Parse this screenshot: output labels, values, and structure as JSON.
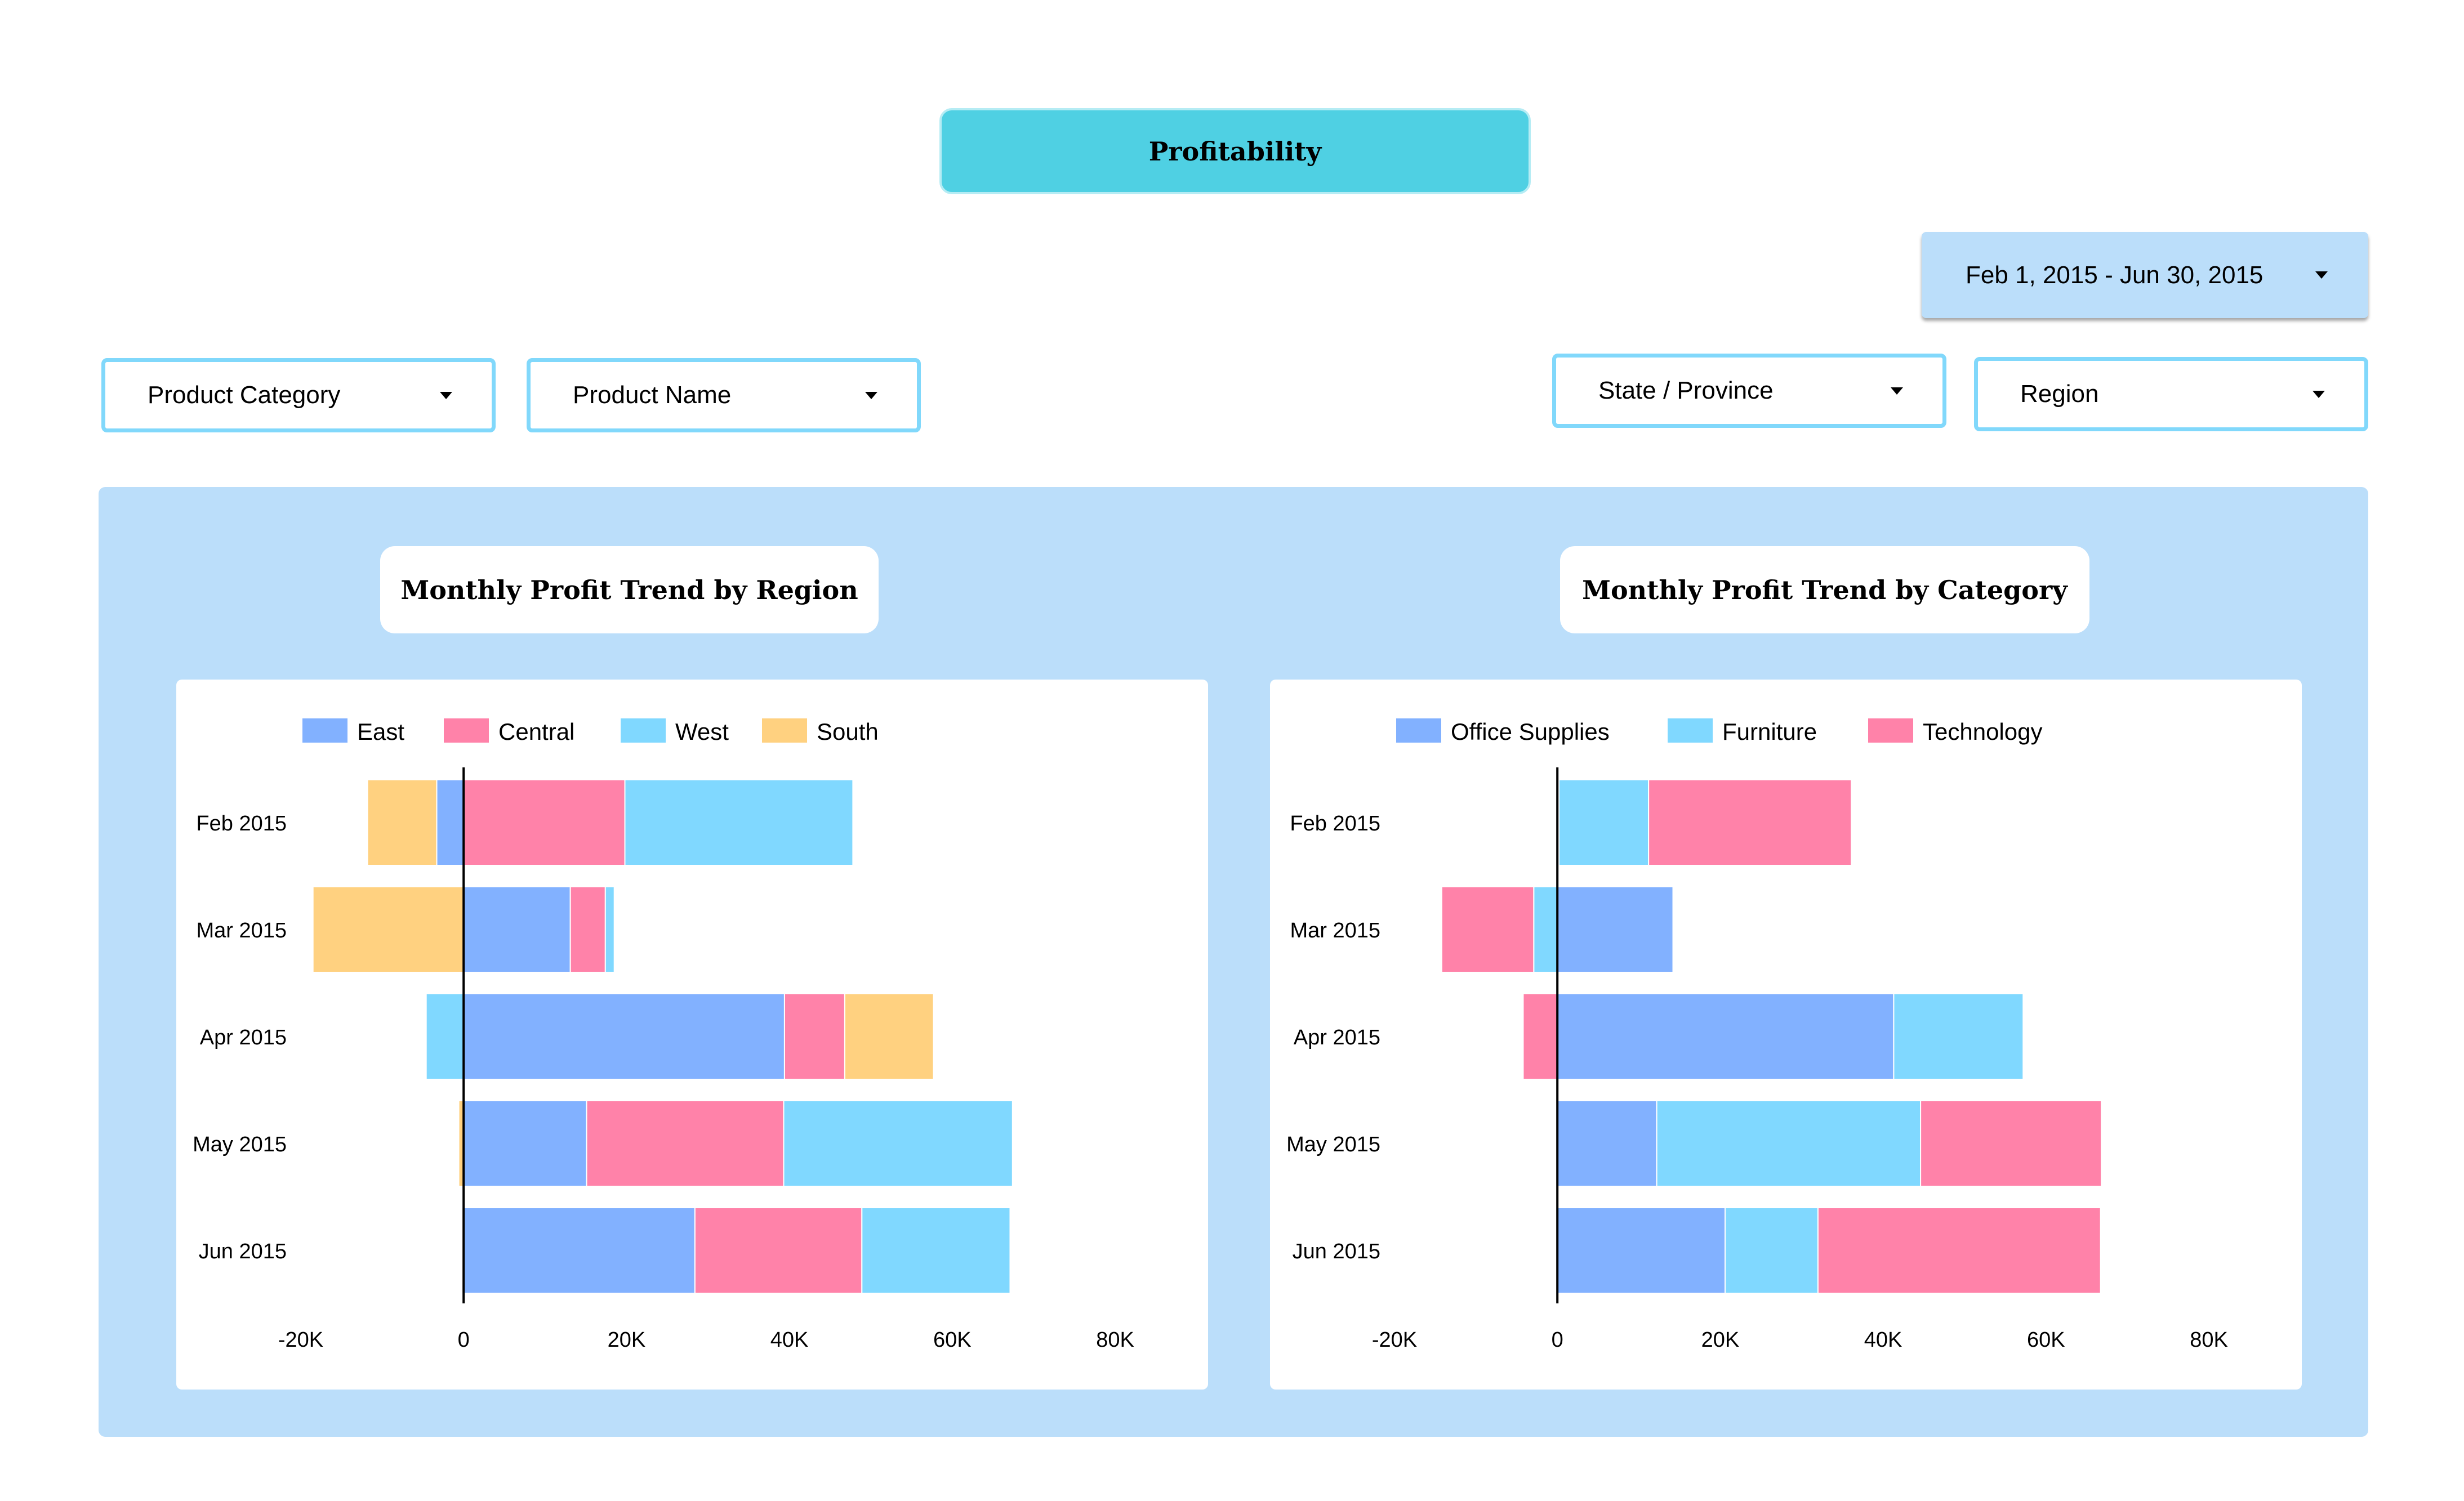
{
  "header": {
    "title": "Profitability"
  },
  "date_range": {
    "label": "Feb 1, 2015 - Jun 30, 2015",
    "icon": "caret-down-icon"
  },
  "filters": [
    {
      "id": "product-category",
      "label": "Product Category"
    },
    {
      "id": "product-name",
      "label": "Product Name"
    },
    {
      "id": "state-province",
      "label": "State / Province"
    },
    {
      "id": "region",
      "label": "Region"
    }
  ],
  "colors": {
    "panel_bg": "#bbdefa",
    "title_bg": "#4fd0e3",
    "blue": "#82b1ff",
    "pink": "#ff82a9",
    "cyan": "#80d8ff",
    "orange": "#ffd180",
    "filter_border": "#81d8fb"
  },
  "chart_data": [
    {
      "type": "bar",
      "orientation": "horizontal",
      "stacked": true,
      "title": "Monthly Profit Trend by Region",
      "categories": [
        "Feb 2015",
        "Mar 2015",
        "Apr 2015",
        "May 2015",
        "Jun 2015"
      ],
      "series": [
        {
          "name": "East",
          "color": "#82b1ff",
          "values": [
            -3300,
            13100,
            39400,
            15100,
            28400
          ]
        },
        {
          "name": "Central",
          "color": "#ff82a9",
          "values": [
            19800,
            4300,
            7400,
            24200,
            20500
          ]
        },
        {
          "name": "West",
          "color": "#80d8ff",
          "values": [
            28000,
            1100,
            -4600,
            28100,
            18200
          ]
        },
        {
          "name": "South",
          "color": "#ffd180",
          "values": [
            -8500,
            -18500,
            10900,
            -600,
            -200
          ]
        }
      ],
      "xlim": [
        -20000,
        80000
      ],
      "xticks": [
        "-20K",
        "0",
        "20K",
        "40K",
        "60K",
        "80K"
      ],
      "xtick_values": [
        -20000,
        0,
        20000,
        40000,
        60000,
        80000
      ],
      "xlabel": "",
      "ylabel": "",
      "legend": "top-left",
      "grid": false
    },
    {
      "type": "bar",
      "orientation": "horizontal",
      "stacked": true,
      "title": "Monthly Profit Trend by Category",
      "categories": [
        "Feb 2015",
        "Mar 2015",
        "Apr 2015",
        "May 2015",
        "Jun 2015"
      ],
      "series": [
        {
          "name": "Office Supplies",
          "color": "#82b1ff",
          "values": [
            200,
            14200,
            41300,
            12200,
            20600
          ]
        },
        {
          "name": "Furniture",
          "color": "#80d8ff",
          "values": [
            11000,
            -2900,
            15900,
            32400,
            11400
          ]
        },
        {
          "name": "Technology",
          "color": "#ff82a9",
          "values": [
            24900,
            -11300,
            -4200,
            22200,
            34700
          ]
        }
      ],
      "xlim": [
        -20000,
        80000
      ],
      "xticks": [
        "-20K",
        "0",
        "20K",
        "40K",
        "60K",
        "80K"
      ],
      "xtick_values": [
        -20000,
        0,
        20000,
        40000,
        60000,
        80000
      ],
      "xlabel": "",
      "ylabel": "",
      "legend": "top-left",
      "grid": false
    }
  ]
}
